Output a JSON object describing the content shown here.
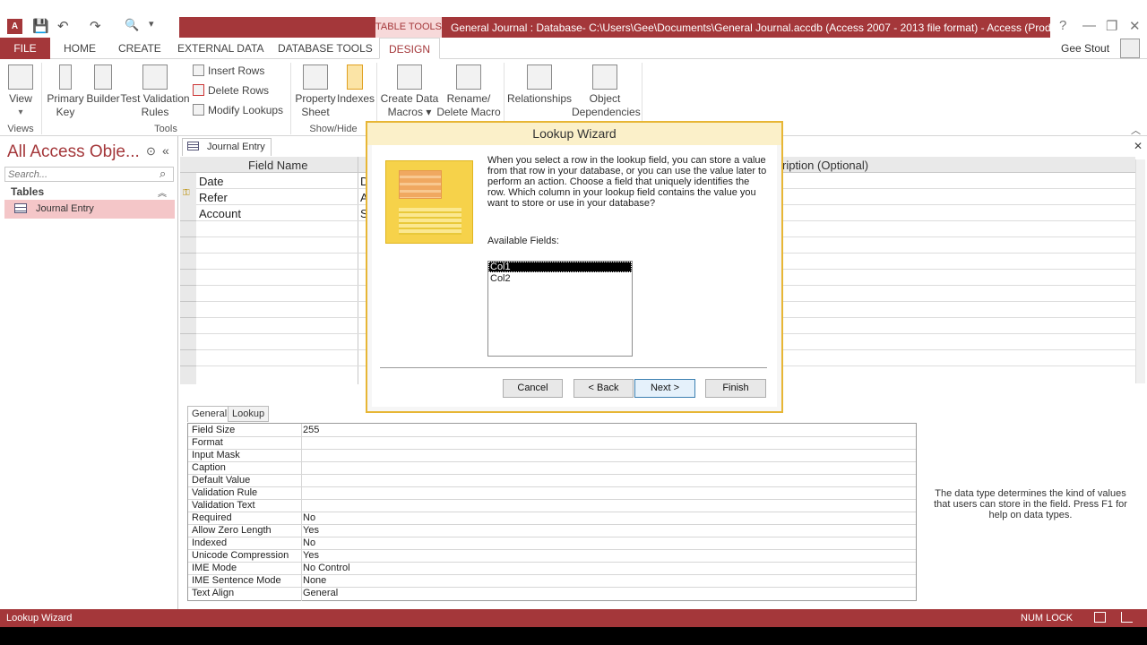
{
  "window": {
    "title": "General Journal : Database- C:\\Users\\Gee\\Documents\\General Journal.accdb (Access 2007 - 2013 file format) - Access (Product Acti...",
    "context_tab": "TABLE TOOLS",
    "app_icon": "A",
    "user": "Gee Stout",
    "help_glyph": "?",
    "minimize_glyph": "—",
    "restore_glyph": "❐",
    "close_glyph": "✕"
  },
  "qat": {
    "save": "💾",
    "undo": "↶",
    "redo": "↷",
    "preview": "🔍",
    "more": "▾"
  },
  "tabs": {
    "file": "FILE",
    "home": "HOME",
    "create": "CREATE",
    "external": "EXTERNAL DATA",
    "dbtools": "DATABASE TOOLS",
    "design": "DESIGN"
  },
  "ribbon": {
    "view": {
      "line1": "View",
      "line2": "▾"
    },
    "primary_key": {
      "line1": "Primary",
      "line2": "Key"
    },
    "builder": {
      "line1": "Builder",
      "line2": ""
    },
    "test_validation": {
      "line1": "Test Validation",
      "line2": "Rules"
    },
    "insert_rows": "Insert Rows",
    "delete_rows": "Delete Rows",
    "modify_lookups": "Modify Lookups",
    "property_sheet": {
      "line1": "Property",
      "line2": "Sheet"
    },
    "indexes": {
      "line1": "Indexes",
      "line2": ""
    },
    "create_data_macros": {
      "line1": "Create Data",
      "line2": "Macros ▾"
    },
    "rename_delete_macro": {
      "line1": "Rename/",
      "line2": "Delete Macro"
    },
    "relationships": {
      "line1": "Relationships",
      "line2": ""
    },
    "object_dependencies": {
      "line1": "Object",
      "line2": "Dependencies"
    },
    "groups": {
      "views": "Views",
      "tools": "Tools",
      "showhide": "Show/Hide"
    },
    "collapse": "︿"
  },
  "nav": {
    "title": "All Access Obje...",
    "search_placeholder": "Search...",
    "section": "Tables",
    "items": [
      {
        "label": "Journal Entry"
      }
    ],
    "menu_glyph": "⊙",
    "collapse_glyph": "«",
    "section_glyph": "︽",
    "search_glyph": "⌕"
  },
  "document": {
    "tab": "Journal Entry",
    "close_glyph": "✕",
    "headers": {
      "field_name": "Field Name",
      "description": "ription (Optional)"
    },
    "rows": [
      {
        "name": "Date",
        "type": "D"
      },
      {
        "name": "Refer",
        "type": "A"
      },
      {
        "name": "Account",
        "type": "S"
      }
    ]
  },
  "field_properties": {
    "tabs": {
      "general": "General",
      "lookup": "Lookup"
    },
    "rows": [
      {
        "name": "Field Size",
        "value": "255"
      },
      {
        "name": "Format",
        "value": ""
      },
      {
        "name": "Input Mask",
        "value": ""
      },
      {
        "name": "Caption",
        "value": ""
      },
      {
        "name": "Default Value",
        "value": ""
      },
      {
        "name": "Validation Rule",
        "value": ""
      },
      {
        "name": "Validation Text",
        "value": ""
      },
      {
        "name": "Required",
        "value": "No"
      },
      {
        "name": "Allow Zero Length",
        "value": "Yes"
      },
      {
        "name": "Indexed",
        "value": "No"
      },
      {
        "name": "Unicode Compression",
        "value": "Yes"
      },
      {
        "name": "IME Mode",
        "value": "No Control"
      },
      {
        "name": "IME Sentence Mode",
        "value": "None"
      },
      {
        "name": "Text Align",
        "value": "General"
      }
    ],
    "help": "The data type determines the kind of values that users can store in the field. Press F1 for help on data types."
  },
  "wizard": {
    "title": "Lookup Wizard",
    "description": "When you select a row in the lookup field, you can store a value from that row in your database, or you can use the value later to perform an action.  Choose a field that uniquely identifies the row. Which column in your lookup field contains the value you want to store or use in your database?",
    "available_label": "Available Fields:",
    "fields": [
      "Col1",
      "Col2"
    ],
    "selected_field": "Col1",
    "buttons": {
      "cancel": "Cancel",
      "back": "< Back",
      "next": "Next >",
      "finish": "Finish"
    }
  },
  "status": {
    "left": "Lookup Wizard",
    "num_lock": "NUM LOCK"
  },
  "colors": {
    "accent": "#a4373a",
    "wizard_border": "#e7b635",
    "wizard_title_bg": "#fbf0c9"
  },
  "icons": [
    "access-app-icon",
    "save-icon",
    "undo-icon",
    "redo-icon",
    "print-preview-icon",
    "view-icon",
    "primary-key-icon",
    "builder-icon",
    "test-validation-icon",
    "property-sheet-icon",
    "indexes-icon",
    "macro-icon",
    "relationships-icon",
    "dependencies-icon",
    "table-icon",
    "key-icon",
    "wizard-illustration",
    "datasheet-view-icon",
    "design-view-icon"
  ]
}
